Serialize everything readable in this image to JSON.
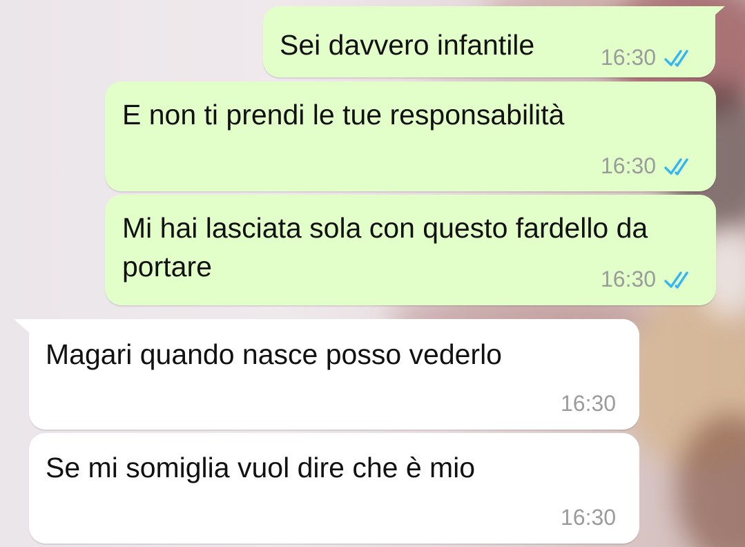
{
  "messages": [
    {
      "direction": "outgoing",
      "text": "Sei davvero infantile",
      "time": "16:30",
      "status_icon": "double-check-read-icon"
    },
    {
      "direction": "outgoing",
      "text": "E non ti prendi le tue responsabilità",
      "time": "16:30",
      "status_icon": "double-check-read-icon"
    },
    {
      "direction": "outgoing",
      "text": "Mi hai lasciata sola con questo fardello da portare",
      "time": "16:30",
      "status_icon": "double-check-read-icon"
    },
    {
      "direction": "incoming",
      "text": "Magari quando nasce posso vederlo",
      "time": "16:30"
    },
    {
      "direction": "incoming",
      "text": "Se mi somiglia vuol dire che è mio",
      "time": "16:30"
    }
  ],
  "colors": {
    "outgoing_bubble": "#e2fec9",
    "incoming_bubble": "#ffffff",
    "read_ticks": "#34b7f1",
    "timestamp": "#9a9c9a"
  }
}
